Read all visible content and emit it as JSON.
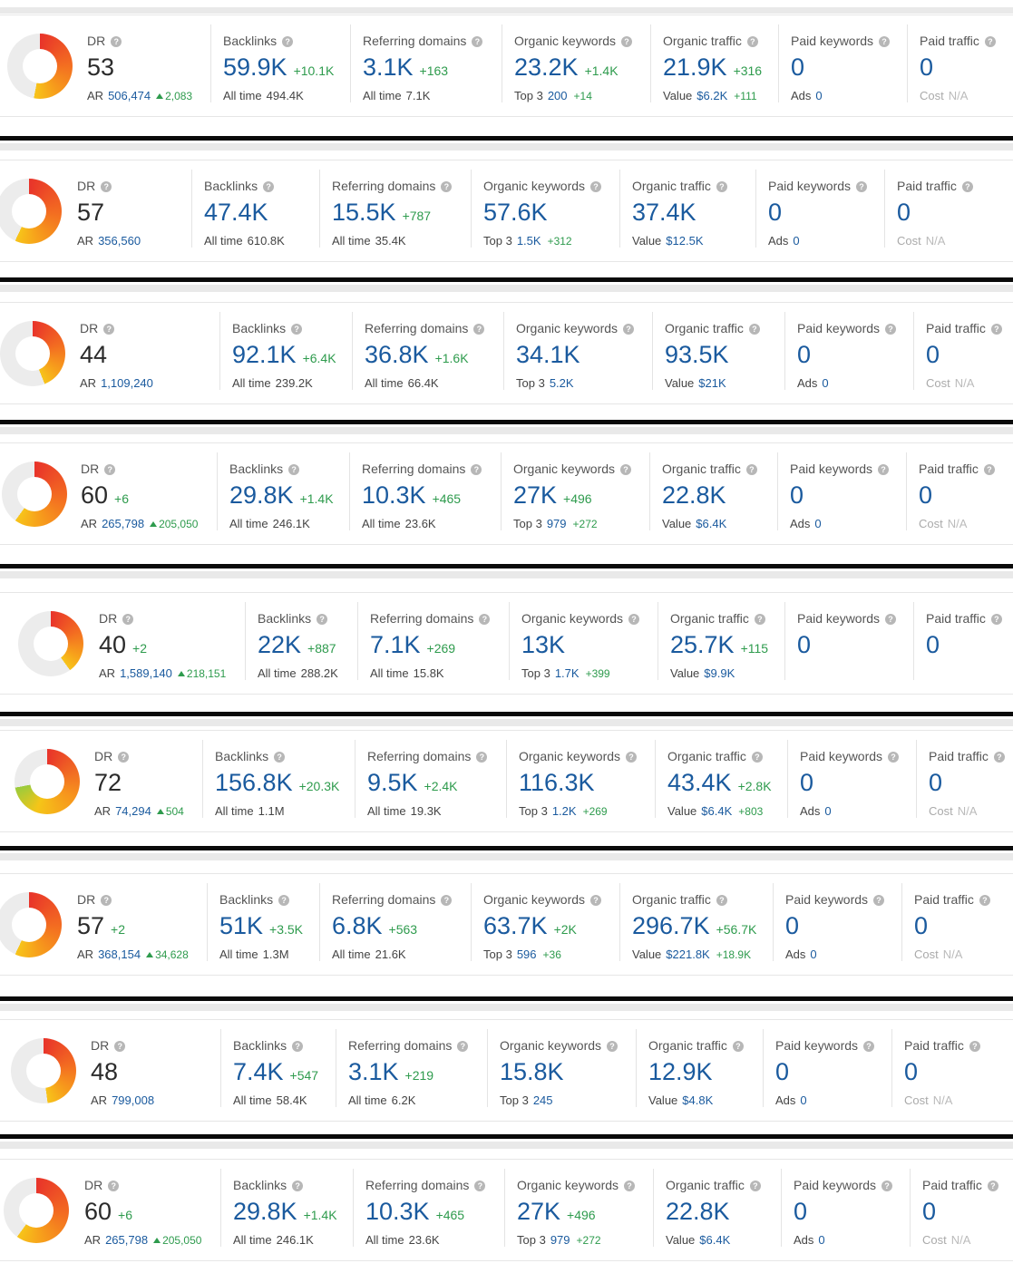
{
  "labels": {
    "dr": "DR",
    "ar": "AR",
    "backlinks": "Backlinks",
    "referring_domains": "Referring domains",
    "organic_keywords": "Organic keywords",
    "organic_traffic": "Organic traffic",
    "paid_keywords": "Paid keywords",
    "paid_traffic": "Paid traffic",
    "all_time": "All time",
    "top3": "Top 3",
    "value": "Value",
    "ads": "Ads",
    "cost": "Cost",
    "help_glyph": "?"
  },
  "colors": {
    "accent_blue": "#1a5a9e",
    "delta_green": "#2e9b4d",
    "donut_track": "#ececec"
  },
  "rows": [
    {
      "dr": "53",
      "dr_delta": "",
      "ar": "506,474",
      "ar_delta": "2,083",
      "backlinks": "59.9K",
      "backlinks_delta": "+10.1K",
      "backlinks_all": "494.4K",
      "ref": "3.1K",
      "ref_delta": "+163",
      "ref_all": "7.1K",
      "okw": "23.2K",
      "okw_delta": "+1.4K",
      "top3": "200",
      "top3_delta": "+14",
      "ot": "21.9K",
      "ot_delta": "+316",
      "value": "$6.2K",
      "value_delta": "+111",
      "pk": "0",
      "ads": "0",
      "pt": "0",
      "cost": "N/A"
    },
    {
      "dr": "57",
      "dr_delta": "",
      "ar": "356,560",
      "ar_delta": "",
      "backlinks": "47.4K",
      "backlinks_delta": "",
      "backlinks_all": "610.8K",
      "ref": "15.5K",
      "ref_delta": "+787",
      "ref_all": "35.4K",
      "okw": "57.6K",
      "okw_delta": "",
      "top3": "1.5K",
      "top3_delta": "+312",
      "ot": "37.4K",
      "ot_delta": "",
      "value": "$12.5K",
      "value_delta": "",
      "pk": "0",
      "ads": "0",
      "pt": "0",
      "cost": "N/A"
    },
    {
      "dr": "44",
      "dr_delta": "",
      "ar": "1,109,240",
      "ar_delta": "",
      "backlinks": "92.1K",
      "backlinks_delta": "+6.4K",
      "backlinks_all": "239.2K",
      "ref": "36.8K",
      "ref_delta": "+1.6K",
      "ref_all": "66.4K",
      "okw": "34.1K",
      "okw_delta": "",
      "top3": "5.2K",
      "top3_delta": "",
      "ot": "93.5K",
      "ot_delta": "",
      "value": "$21K",
      "value_delta": "",
      "pk": "0",
      "ads": "0",
      "pt": "0",
      "cost": "N/A"
    },
    {
      "dr": "60",
      "dr_delta": "+6",
      "ar": "265,798",
      "ar_delta": "205,050",
      "backlinks": "29.8K",
      "backlinks_delta": "+1.4K",
      "backlinks_all": "246.1K",
      "ref": "10.3K",
      "ref_delta": "+465",
      "ref_all": "23.6K",
      "okw": "27K",
      "okw_delta": "+496",
      "top3": "979",
      "top3_delta": "+272",
      "ot": "22.8K",
      "ot_delta": "",
      "value": "$6.4K",
      "value_delta": "",
      "pk": "0",
      "ads": "0",
      "pt": "0",
      "cost": "N/A"
    },
    {
      "dr": "40",
      "dr_delta": "+2",
      "ar": "1,589,140",
      "ar_delta": "218,151",
      "backlinks": "22K",
      "backlinks_delta": "+887",
      "backlinks_all": "288.2K",
      "ref": "7.1K",
      "ref_delta": "+269",
      "ref_all": "15.8K",
      "okw": "13K",
      "okw_delta": "",
      "top3": "1.7K",
      "top3_delta": "+399",
      "ot": "25.7K",
      "ot_delta": "+115",
      "value": "$9.9K",
      "value_delta": "",
      "pk": "0",
      "ads": "",
      "pt": "0",
      "cost": ""
    },
    {
      "dr": "72",
      "dr_delta": "",
      "ar": "74,294",
      "ar_delta": "504",
      "backlinks": "156.8K",
      "backlinks_delta": "+20.3K",
      "backlinks_all": "1.1M",
      "ref": "9.5K",
      "ref_delta": "+2.4K",
      "ref_all": "19.3K",
      "okw": "116.3K",
      "okw_delta": "",
      "top3": "1.2K",
      "top3_delta": "+269",
      "ot": "43.4K",
      "ot_delta": "+2.8K",
      "value": "$6.4K",
      "value_delta": "+803",
      "pk": "0",
      "ads": "0",
      "pt": "0",
      "cost": "N/A"
    },
    {
      "dr": "57",
      "dr_delta": "+2",
      "ar": "368,154",
      "ar_delta": "34,628",
      "backlinks": "51K",
      "backlinks_delta": "+3.5K",
      "backlinks_all": "1.3M",
      "ref": "6.8K",
      "ref_delta": "+563",
      "ref_all": "21.6K",
      "okw": "63.7K",
      "okw_delta": "+2K",
      "top3": "596",
      "top3_delta": "+36",
      "ot": "296.7K",
      "ot_delta": "+56.7K",
      "value": "$221.8K",
      "value_delta": "+18.9K",
      "pk": "0",
      "ads": "0",
      "pt": "0",
      "cost": "N/A"
    },
    {
      "dr": "48",
      "dr_delta": "",
      "ar": "799,008",
      "ar_delta": "",
      "backlinks": "7.4K",
      "backlinks_delta": "+547",
      "backlinks_all": "58.4K",
      "ref": "3.1K",
      "ref_delta": "+219",
      "ref_all": "6.2K",
      "okw": "15.8K",
      "okw_delta": "",
      "top3": "245",
      "top3_delta": "",
      "ot": "12.9K",
      "ot_delta": "",
      "value": "$4.8K",
      "value_delta": "",
      "pk": "0",
      "ads": "0",
      "pt": "0",
      "cost": "N/A"
    },
    {
      "dr": "60",
      "dr_delta": "+6",
      "ar": "265,798",
      "ar_delta": "205,050",
      "backlinks": "29.8K",
      "backlinks_delta": "+1.4K",
      "backlinks_all": "246.1K",
      "ref": "10.3K",
      "ref_delta": "+465",
      "ref_all": "23.6K",
      "okw": "27K",
      "okw_delta": "+496",
      "top3": "979",
      "top3_delta": "+272",
      "ot": "22.8K",
      "ot_delta": "",
      "value": "$6.4K",
      "value_delta": "",
      "pk": "0",
      "ads": "0",
      "pt": "0",
      "cost": "N/A"
    }
  ]
}
